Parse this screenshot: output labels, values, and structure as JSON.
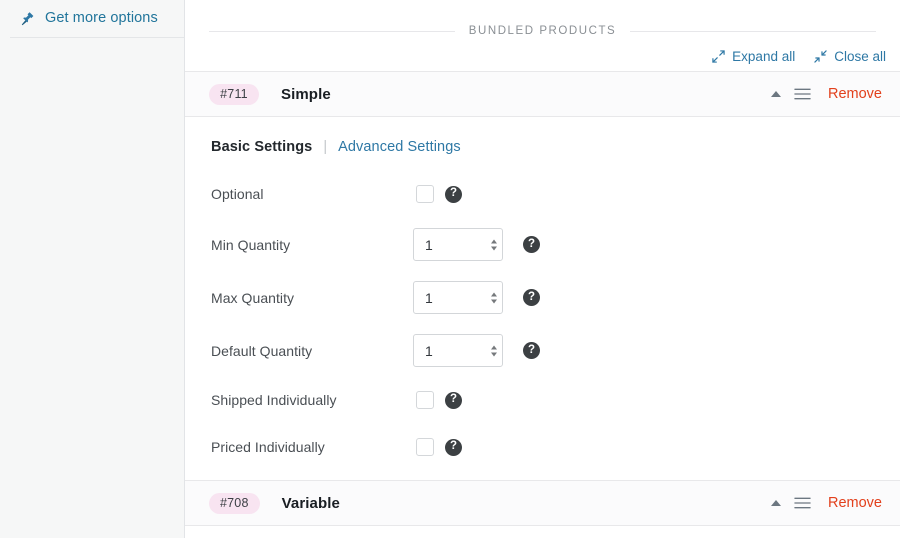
{
  "sidebar": {
    "link": {
      "label": "Get more options",
      "icon": "plug-icon"
    }
  },
  "section": {
    "caption": "BUNDLED PRODUCTS"
  },
  "toolbar": {
    "expand_label": "Expand all",
    "expand_icon": "expand-arrows-icon",
    "close_label": "Close all",
    "close_icon": "collapse-arrows-icon"
  },
  "items": [
    {
      "badge": "#711",
      "title": "Simple",
      "collapse_icon": "caret-up-icon",
      "drag_icon": "drag-handle-icon",
      "remove_label": "Remove",
      "tabs": {
        "active": "Basic Settings",
        "separator": "|",
        "link": "Advanced Settings"
      },
      "fields": [
        {
          "label": "Optional",
          "type": "checkbox",
          "checked": false,
          "help": "?"
        },
        {
          "label": "Min Quantity",
          "type": "number",
          "value": "1",
          "help": "?"
        },
        {
          "label": "Max Quantity",
          "type": "number",
          "value": "1",
          "help": "?"
        },
        {
          "label": "Default Quantity",
          "type": "number",
          "value": "1",
          "help": "?"
        },
        {
          "label": "Shipped Individually",
          "type": "checkbox",
          "checked": false,
          "help": "?"
        },
        {
          "label": "Priced Individually",
          "type": "checkbox",
          "checked": false,
          "help": "?"
        }
      ]
    },
    {
      "badge": "#708",
      "title": "Variable",
      "collapse_icon": "caret-up-icon",
      "drag_icon": "drag-handle-icon",
      "remove_label": "Remove"
    }
  ],
  "colors": {
    "link": "#2e78a5",
    "remove": "#e2401c",
    "badge_bg": "#f8e4f1",
    "sidebar_bg": "#f6f7f7",
    "row_header_bg": "#fbfbfc",
    "border": "#e8e8ea",
    "help_bg": "#3c4043"
  }
}
